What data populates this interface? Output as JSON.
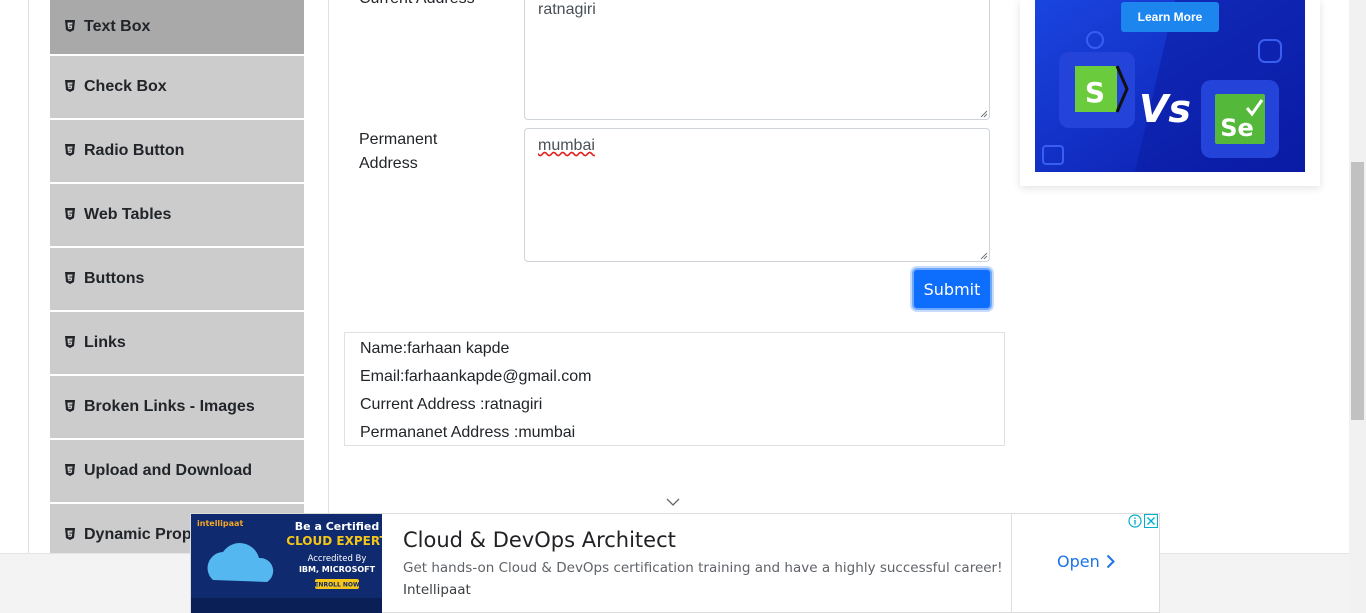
{
  "sidebar": {
    "items": [
      {
        "label": "Text Box"
      },
      {
        "label": "Check Box"
      },
      {
        "label": "Radio Button"
      },
      {
        "label": "Web Tables"
      },
      {
        "label": "Buttons"
      },
      {
        "label": "Links"
      },
      {
        "label": "Broken Links - Images"
      },
      {
        "label": "Upload and Download"
      },
      {
        "label": "Dynamic Properties"
      }
    ]
  },
  "form": {
    "current_address_label": "Current Address",
    "current_address_value": "ratnagiri",
    "permanent_address_label_line1": "Permanent",
    "permanent_address_label_line2": "Address",
    "permanent_address_value": "mumbai",
    "submit_label": "Submit"
  },
  "output": {
    "name": "Name:farhaan kapde",
    "email": "Email:farhaankapde@gmail.com",
    "current_address": "Current Address :ratnagiri",
    "permanent_address": "Permananet Address :mumbai"
  },
  "side_ad": {
    "button_label": "Learn More",
    "vs_text": "Vs",
    "right_logo_text": "Se",
    "left_logo_text": "S"
  },
  "banner_ad": {
    "image_line1": "Be a Certified",
    "image_line2": "CLOUD EXPERT",
    "image_line3": "Accredited By",
    "image_line4": "IBM, MICROSOFT",
    "image_cta": "ENROLL NOW",
    "image_brand": "intellipaat",
    "title": "Cloud & DevOps Architect",
    "description": "Get hands-on Cloud & DevOps certification training and have a highly successful career!",
    "advertiser": "Intellipaat",
    "open_label": "Open"
  },
  "colors": {
    "sidebar_bg": "#cccccc",
    "sidebar_active_bg": "#a9a9a9",
    "primary": "#0d6efd",
    "ad_blue": "#1033c8",
    "link_blue": "#1a73e8"
  }
}
